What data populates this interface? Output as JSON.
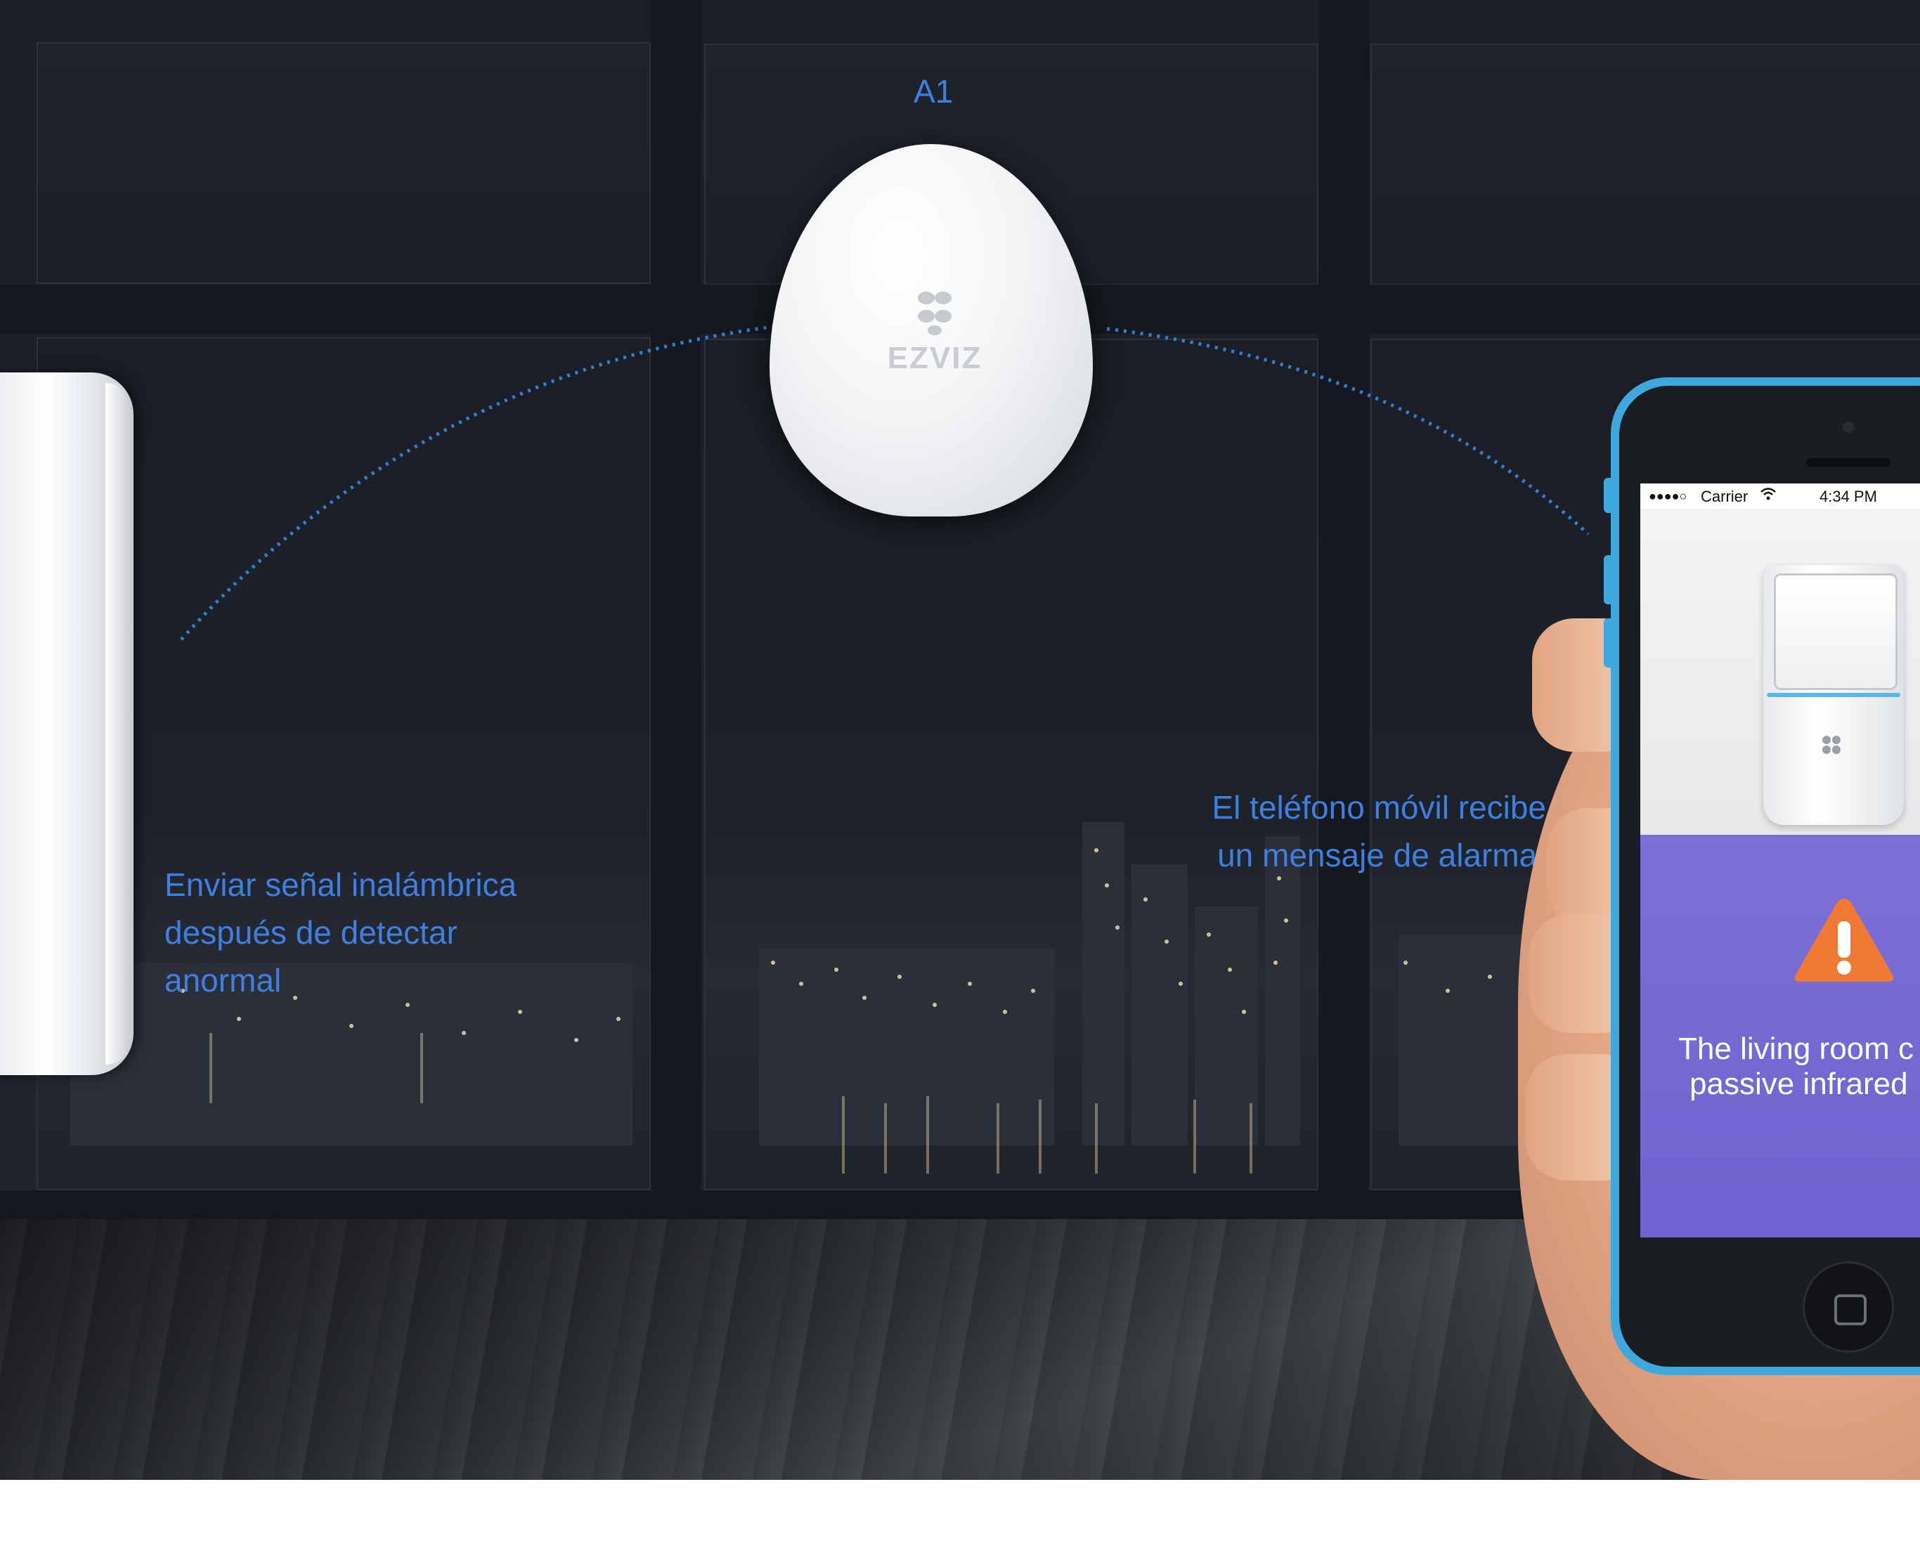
{
  "hub": {
    "label": "A1",
    "brand": "EZVIZ"
  },
  "captions": {
    "left": [
      "Enviar señal inalámbrica",
      "después de detectar",
      "anormal"
    ],
    "right": [
      "El teléfono móvil recibe",
      "un mensaje de alarma."
    ]
  },
  "phone": {
    "status_signal": "●●●●○",
    "status_carrier": "Carrier",
    "status_time": "4:34 PM",
    "alert_lines": [
      "The living room c",
      "passive infrared"
    ]
  },
  "colors": {
    "caption": "#3f7fe0",
    "alarm_bg": "#7b6fd8",
    "warning": "#f07a35",
    "phone_frame": "#3fa9df"
  },
  "icons": [
    "warning-icon",
    "ezviz-logo-icon",
    "wifi-icon",
    "home-button-icon"
  ]
}
